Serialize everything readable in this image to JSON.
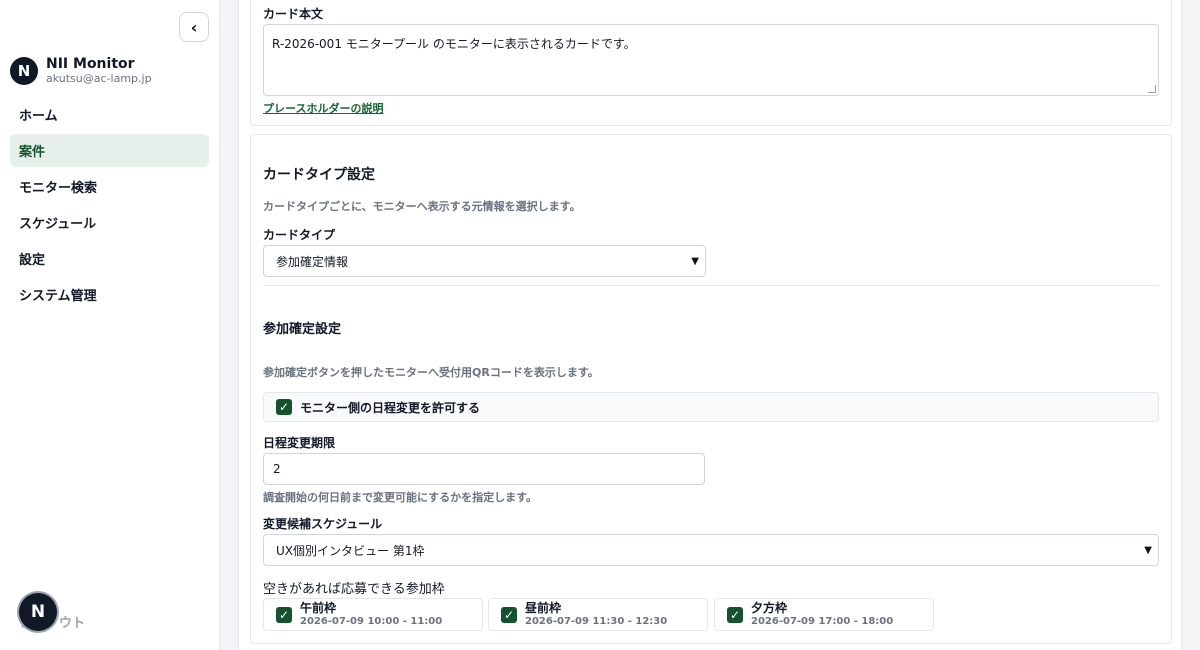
{
  "sidebar": {
    "collapse_label": "‹",
    "profile": {
      "initial": "N",
      "name": "NII Monitor",
      "email": "akutsu@ac-lamp.jp"
    },
    "items": [
      {
        "label": "ホーム"
      },
      {
        "label": "案件"
      },
      {
        "label": "モニター検索"
      },
      {
        "label": "スケジュール"
      },
      {
        "label": "設定"
      },
      {
        "label": "システム管理"
      }
    ],
    "active_item": "案件",
    "logout_label": "ログアウト",
    "fab_initial": "N"
  },
  "card_body": {
    "label": "カード本文",
    "value": "R-2026-001 モニタープール のモニターに表示されるカードです。",
    "placeholder_link": "プレースホルダーの説明"
  },
  "card_type": {
    "title": "カードタイプ設定",
    "description": "カードタイプごとに、モニターへ表示する元情報を選択します。",
    "select_label": "カードタイプ",
    "select_value": "参加確定情報"
  },
  "participation": {
    "title": "参加確定設定",
    "description": "参加確定ボタンを押したモニターへ受付用QRコードを表示します。",
    "allow_change_label": "モニター側の日程変更を許可する",
    "allow_change_checked": true,
    "deadline_label": "日程変更期限",
    "deadline_value": "2",
    "deadline_help": "調査開始の何日前まで変更可能にするかを指定します。",
    "schedule_label": "変更候補スケジュール",
    "schedule_value": "UX個別インタビュー 第1枠",
    "slots_label": "空きがあれば応募できる参加枠",
    "slots": [
      {
        "name": "午前枠",
        "time": "2026-07-09 10:00 - 11:00",
        "checked": true
      },
      {
        "name": "昼前枠",
        "time": "2026-07-09 11:30 - 12:30",
        "checked": true
      },
      {
        "name": "夕方枠",
        "time": "2026-07-09 17:00 - 18:00",
        "checked": true
      }
    ]
  },
  "colors": {
    "accent": "#14532d",
    "active_bg": "#e6efe9",
    "link": "#166534"
  }
}
